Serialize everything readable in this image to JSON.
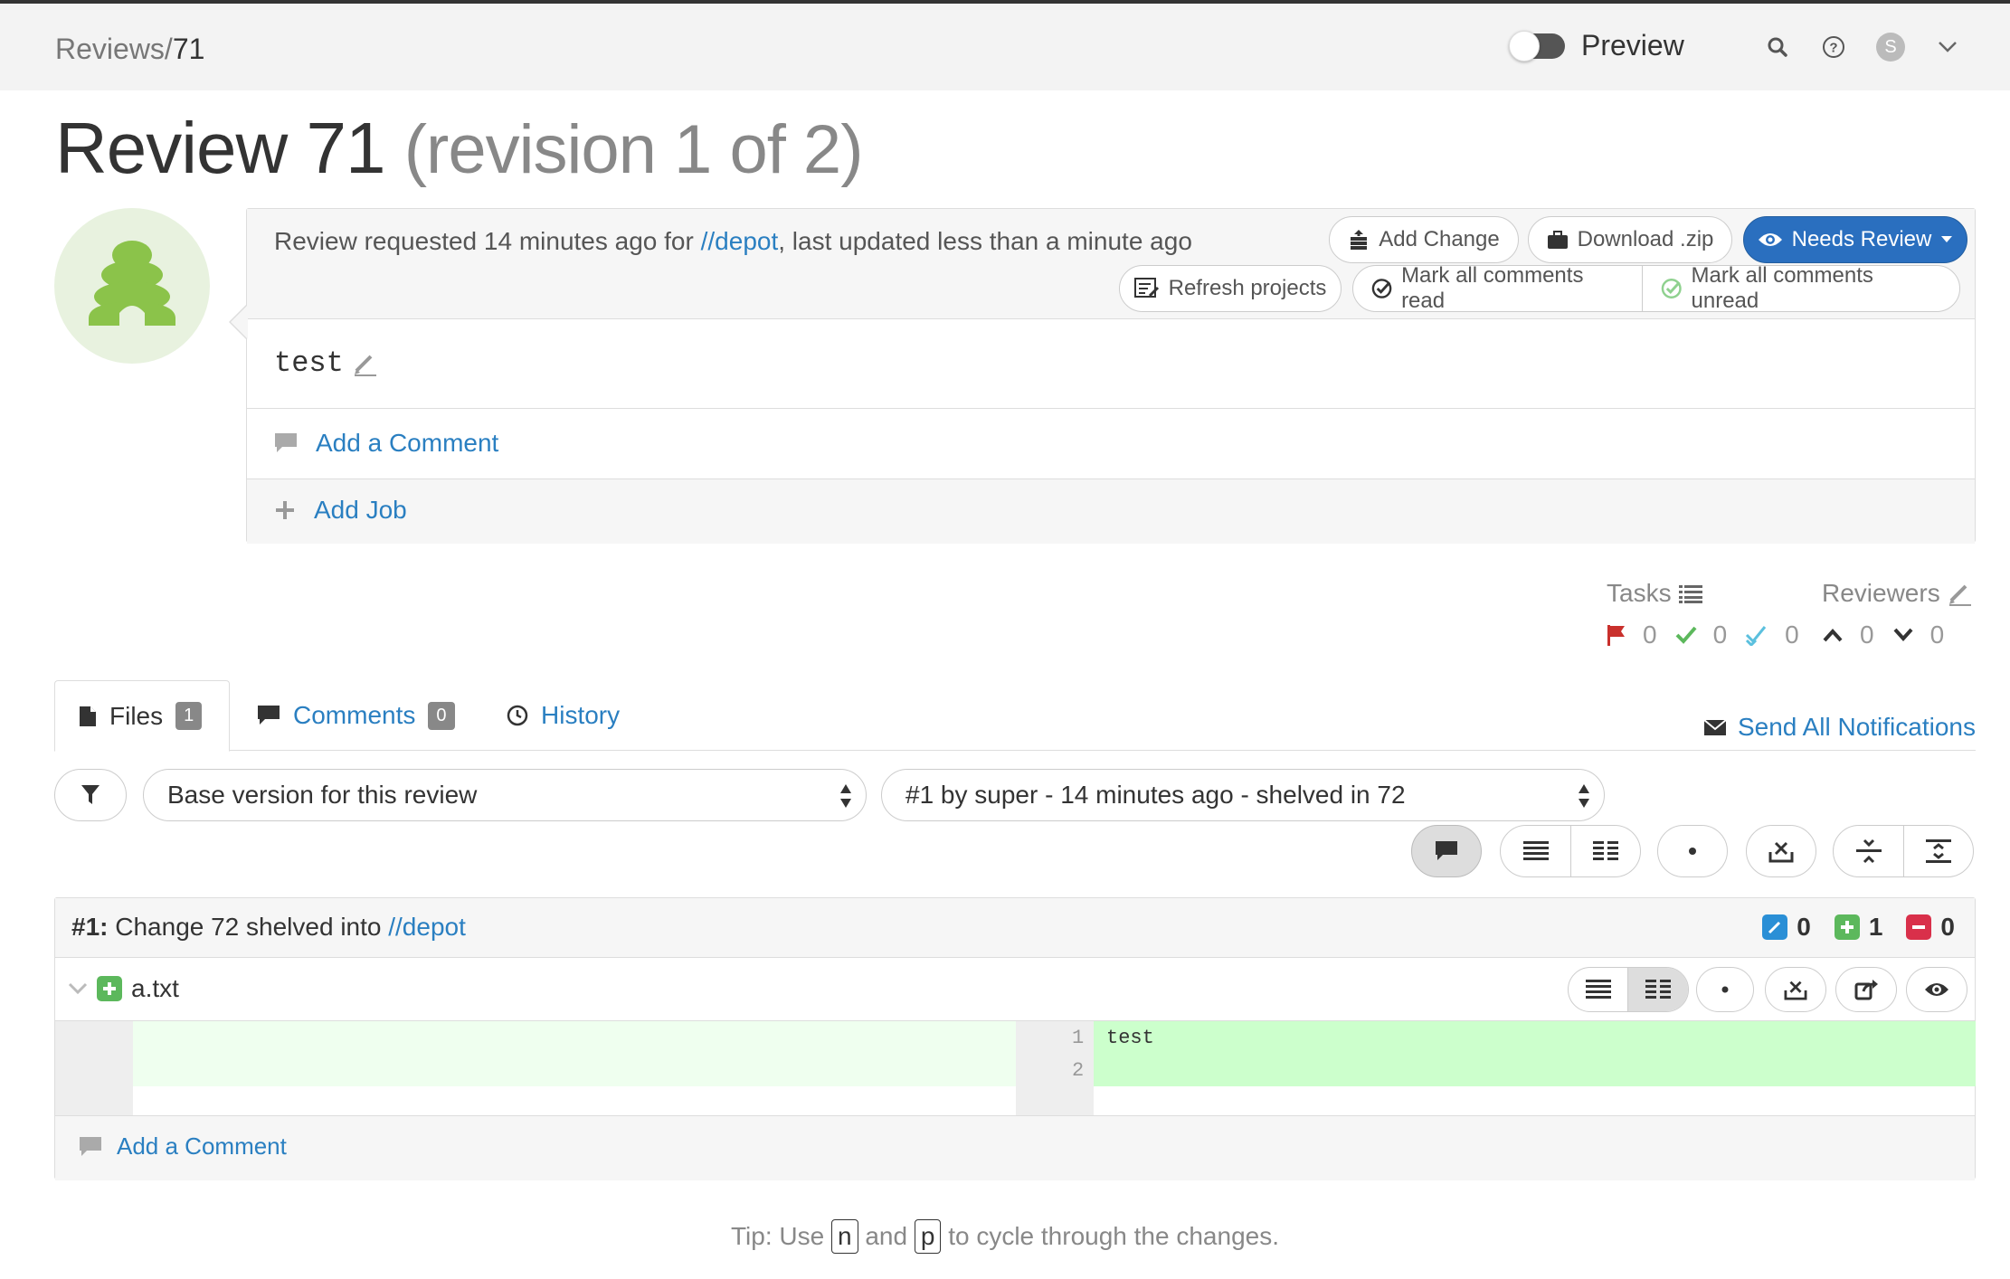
{
  "breadcrumb": {
    "root": "Reviews/",
    "num": "71"
  },
  "header": {
    "preview_label": "Preview",
    "user_initial": "S"
  },
  "title": {
    "main": "Review 71",
    "revision": "(revision 1 of 2)"
  },
  "summary": {
    "prefix": "Review requested 14 minutes ago for ",
    "link": "//depot",
    "suffix": ", last updated less than a minute ago"
  },
  "actions": {
    "add_change": "Add Change",
    "download_zip": "Download .zip",
    "needs_review": "Needs Review",
    "refresh_projects": "Refresh projects",
    "mark_read": "Mark all comments read",
    "mark_unread": "Mark all comments unread"
  },
  "description": "test",
  "add_comment": "Add a Comment",
  "add_job": "Add Job",
  "tasks": {
    "label": "Tasks",
    "open": "0",
    "done": "0",
    "verified": "0"
  },
  "reviewers": {
    "label": "Reviewers",
    "up": "0",
    "down": "0"
  },
  "tabs": {
    "files": {
      "label": "Files",
      "count": "1"
    },
    "comments": {
      "label": "Comments",
      "count": "0"
    },
    "history": {
      "label": "History"
    }
  },
  "send_all": "Send All Notifications",
  "selects": {
    "base": "Base version for this review",
    "target": "#1 by super - 14 minutes ago - shelved in 72"
  },
  "change": {
    "num": "#1:",
    "text": "Change 72 shelved into ",
    "link": "//depot",
    "edited": "0",
    "added": "1",
    "deleted": "0"
  },
  "file": {
    "name": "a.txt"
  },
  "diff": {
    "lines": [
      "1",
      "2"
    ],
    "code": "test"
  },
  "footer_comment": "Add a Comment",
  "tip": {
    "prefix": "Tip: Use ",
    "key1": "n",
    "and": " and ",
    "key2": "p",
    "suffix": " to cycle through the changes."
  },
  "colors": {
    "accent": "#2a7fc1",
    "primary": "#2a6fbf",
    "added_bg": "#ccffcc",
    "added_left": "#efffef",
    "deleted": "#d9304a",
    "add": "#5cb85c",
    "edit": "#2a8fd6"
  }
}
